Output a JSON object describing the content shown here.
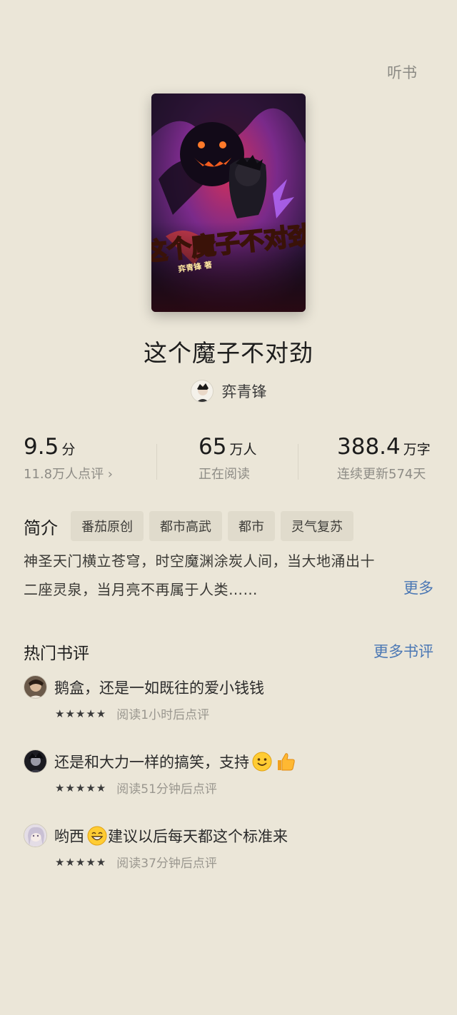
{
  "header": {
    "listen_label": "听书"
  },
  "book": {
    "cover_title_text": "这个魔子不对劲",
    "cover_author_text": "弈青锋 著",
    "title": "这个魔子不对劲",
    "author": "弈青锋"
  },
  "stats": {
    "rating": {
      "value": "9.5",
      "unit": "分",
      "sub": "11.8万人点评 ›"
    },
    "readers": {
      "value": "65",
      "unit": "万人",
      "sub": "正在阅读"
    },
    "words": {
      "value": "388.4",
      "unit": "万字",
      "sub": "连续更新574天"
    }
  },
  "intro": {
    "label": "简介",
    "tags": [
      "番茄原创",
      "都市高武",
      "都市",
      "灵气复苏"
    ],
    "line1": "神圣天门横立苍穹，时空魔渊涂炭人间，当大地涌出十",
    "line2": "二座灵泉，当月亮不再属于人类……",
    "more_label": "更多"
  },
  "reviews": {
    "title": "热门书评",
    "more_label": "更多书评",
    "items": [
      {
        "text": "鹅盒，还是一如既往的爱小钱钱",
        "stars": "★★★★★",
        "time": "阅读1小时后点评"
      },
      {
        "text": "还是和大力一样的搞笑，支持",
        "stars": "★★★★★",
        "time": "阅读51分钟后点评"
      },
      {
        "text_before": "哟西",
        "text_after": "建议以后每天都这个标准来",
        "stars": "★★★★★",
        "time": "阅读37分钟后点评"
      }
    ]
  },
  "colors": {
    "background": "#ebe6d8",
    "link": "#4a77b4",
    "tag_bg": "#e0dbcc"
  }
}
